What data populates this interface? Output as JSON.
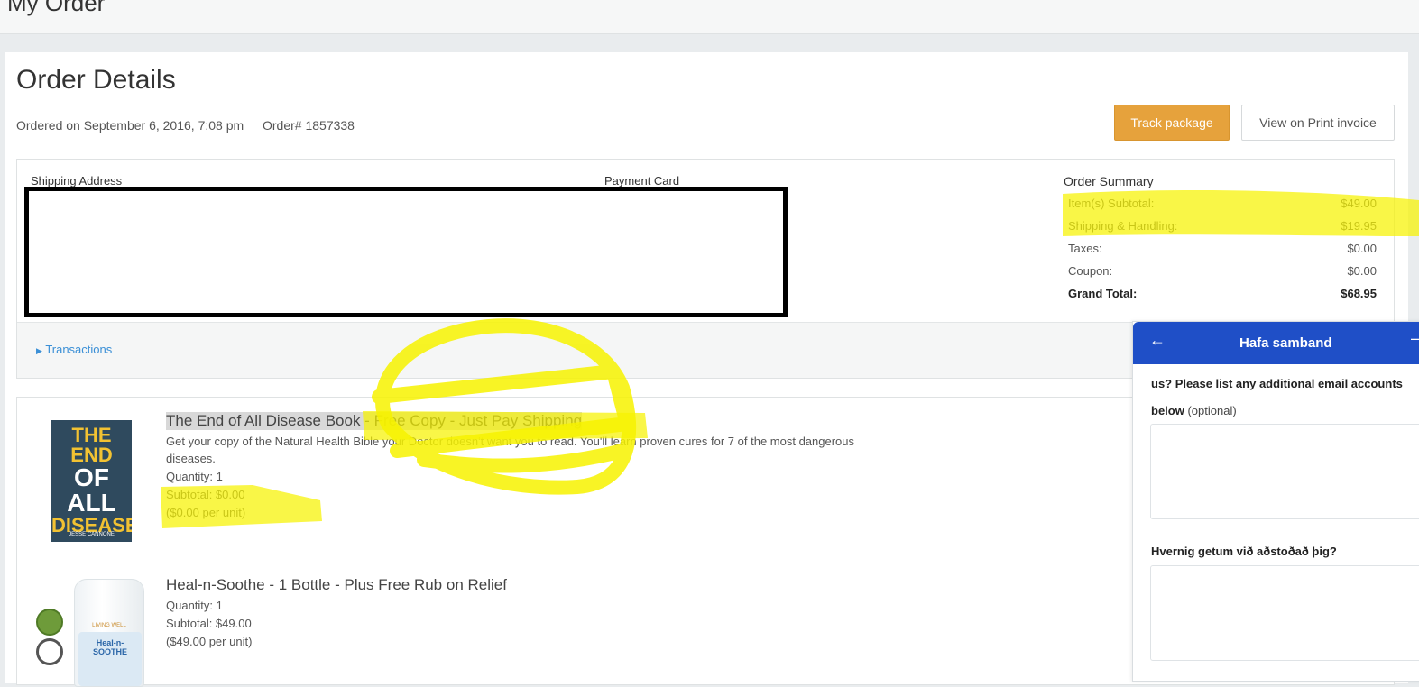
{
  "header": {
    "title": "My Order"
  },
  "order": {
    "title": "Order Details",
    "ordered_on": "Ordered on September 6, 2016, 7:08 pm",
    "order_number": "Order# 1857338",
    "track_button": "Track package",
    "print_button": "View on Print invoice"
  },
  "info": {
    "shipping_label": "Shipping Address",
    "payment_label": "Payment Card",
    "summary_label": "Order Summary",
    "summary": [
      {
        "label": "Item(s) Subtotal:",
        "value": "$49.00"
      },
      {
        "label": "Shipping & Handling:",
        "value": "$19.95"
      },
      {
        "label": "Taxes:",
        "value": "$0.00"
      },
      {
        "label": "Coupon:",
        "value": "$0.00"
      },
      {
        "label": "Grand Total:",
        "value": "$68.95"
      }
    ]
  },
  "transactions_label": "Transactions",
  "items": [
    {
      "title": "The End of All Disease Book - Free Copy - Just Pay Shipping",
      "desc_1": "Get your copy of the Natural Health Bible your Doctor doesn't want you to read. You'll learn proven cures for 7 of the most dangerous",
      "desc_2": "diseases.",
      "quantity": "Quantity: 1",
      "subtotal": "Subtotal: $0.00",
      "per_unit": "($0.00 per unit)",
      "cover": {
        "line1": "THE END",
        "line2": "OF ALL",
        "line3": "DISEASE",
        "author": "JESSE CANNONE"
      }
    },
    {
      "title": "Heal-n-Soothe - 1 Bottle - Plus Free Rub on Relief",
      "quantity": "Quantity: 1",
      "subtotal": "Subtotal: $49.00",
      "per_unit": "($49.00 per unit)",
      "bottle": {
        "brand": "LIVING WELL",
        "label1": "Heal-n-",
        "label2": "SOOTHE"
      }
    }
  ],
  "chat": {
    "title": "Hafa samband",
    "line1": "us? Please list any additional email accounts",
    "line2_bold": "below",
    "line2_opt": "(optional)",
    "question": "Hvernig getum við aðstoðað þig?"
  },
  "colors": {
    "accent": "#e6a23c",
    "chat_header": "#1f4fc7",
    "highlight": "#f7f300",
    "link": "#3a8fd6"
  }
}
